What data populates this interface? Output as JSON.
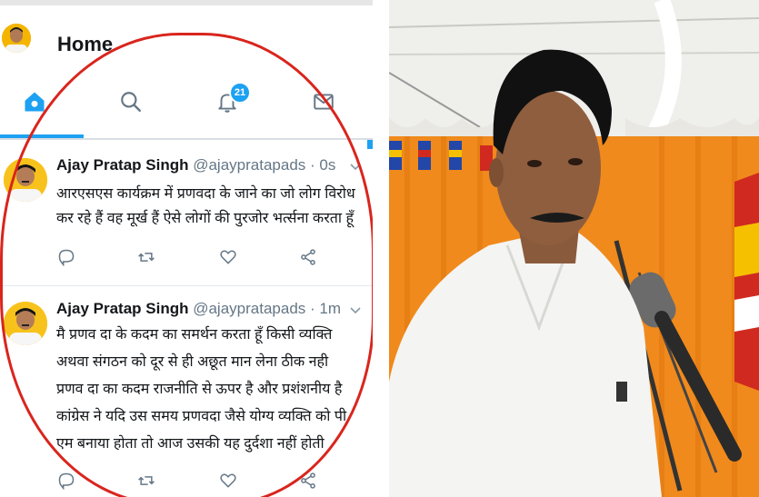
{
  "header": {
    "title": "Home"
  },
  "tabs": {
    "notifications_badge": "21"
  },
  "tweets": [
    {
      "name": "Ajay Pratap Singh",
      "handle": "@ajaypratapads",
      "time": "· 0s",
      "lines": [
        "आरएसएस कार्यक्रम में प्रणवदा के जाने का जो लोग विरोध",
        "कर रहे हैं वह मूर्ख हैं ऐसे लोगों की पुरजोर भर्त्सना करता हूँ"
      ]
    },
    {
      "name": "Ajay Pratap Singh",
      "handle": "@ajaypratapads",
      "time": "· 1m",
      "lines": [
        "मै प्रणव दा के कदम का समर्थन करता हूँ किसी व्यक्ति",
        "अथवा संगठन को दूर से ही अछूत मान लेना ठीक नही",
        "प्रणव दा का कदम राजनीति से ऊपर है और प्रशंशनीय है",
        "कांग्रेस ने यदि उस समय प्रणवदा जैसे योग्य व्यक्ति को पी",
        "एम बनाया होता तो आज उसकी यह दुर्दशा नहीं होती"
      ]
    }
  ],
  "colors": {
    "accent": "#1da1f2",
    "annotation_red": "#d9251d",
    "tent_orange": "#f08a1c"
  },
  "icons": [
    "home-icon",
    "search-icon",
    "bell-icon",
    "mail-icon",
    "reply-icon",
    "retweet-icon",
    "like-icon",
    "share-icon",
    "chevron-down-icon"
  ]
}
